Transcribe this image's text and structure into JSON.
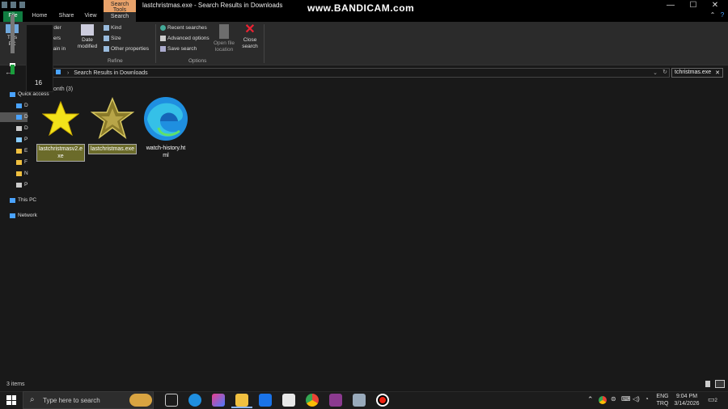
{
  "window": {
    "title": "lastchristmas.exe - Search Results in Downloads",
    "watermark": "www.BANDICAM.com",
    "minimize_glyph": "—",
    "maximize_glyph": "☐",
    "close_glyph": "✕"
  },
  "ribbon_tabs": {
    "file": "File",
    "home": "Home",
    "share": "Share",
    "view": "View",
    "search": "Search",
    "contextual_label": "Search Tools"
  },
  "ribbon": {
    "this_pc_line1": "This",
    "this_pc_line2": "PC",
    "current_folder": "Current folder",
    "all_subfolders": "All subfolders",
    "search_again": "Search again in",
    "date_modified_line1": "Date",
    "date_modified_line2": "modified",
    "kind": "Kind",
    "size": "Size",
    "other_properties": "Other properties",
    "refine_label": "Refine",
    "recent_searches": "Recent searches",
    "advanced_options": "Advanced options",
    "save_search": "Save search",
    "open_file_location_line1": "Open file",
    "open_file_location_line2": "location",
    "close_search_line1": "Close",
    "close_search_line2": "search",
    "options_label": "Options"
  },
  "address": {
    "path": "Search Results in Downloads",
    "search_value": "tchristmas.exe",
    "clear_glyph": "✕"
  },
  "nav": {
    "quick_access": "Quick access",
    "desktop": "D",
    "downloads": "D",
    "documents": "D",
    "pictures": "P",
    "folder_e": "E",
    "folder_f": "F",
    "folder_n": "N",
    "folder_p": "P",
    "this_pc": "This PC",
    "network": "Network"
  },
  "volume_overlay": {
    "level": 16
  },
  "content": {
    "group_header": "onth (3)",
    "files": [
      {
        "name_line1": "lastchristmasv2.e",
        "name_line2": "xe"
      },
      {
        "name_line1": "lastchristmas.exe",
        "name_line2": ""
      },
      {
        "name_line1": "watch-history.ht",
        "name_line2": "ml"
      }
    ]
  },
  "status": {
    "items": "3 items"
  },
  "taskbar": {
    "search_placeholder": "Type here to search",
    "lang_line1": "ENG",
    "lang_line2": "TRQ",
    "time": "9:04 PM",
    "date": "3/14/2026",
    "notification_count": "2"
  }
}
